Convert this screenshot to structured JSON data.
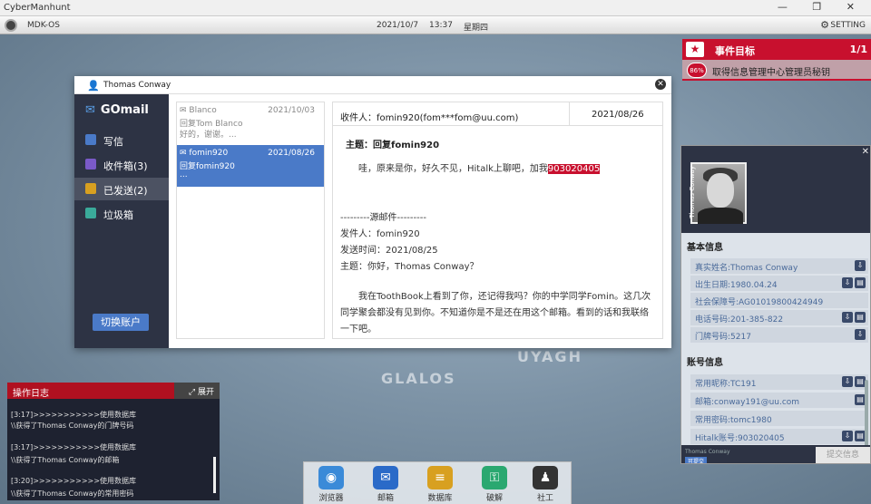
{
  "window": {
    "title": "CyberManhunt",
    "controls": "— ❐ ✕"
  },
  "topbar": {
    "os_name": "MDK-OS",
    "date": "2021/10/7",
    "time": "13:37",
    "weekday": "星期四",
    "setting_label": "SETTING"
  },
  "map_labels": [
    "GLALOS",
    "UYAGH"
  ],
  "mission": {
    "title": "事件目标",
    "progress": "1/1",
    "percent": "86%",
    "task": "取得信息管理中心管理员秘钥"
  },
  "mail": {
    "window_title": "Thomas Conway",
    "app_name": "GOmail",
    "nav": [
      {
        "label": "写信",
        "color": "#4a7ac8"
      },
      {
        "label": "收件箱(3)",
        "color": "#7a5ac8"
      },
      {
        "label": "已发送(2)",
        "color": "#d8a020"
      },
      {
        "label": "垃圾箱",
        "color": "#3aaa9a"
      }
    ],
    "switch_label": "切换账户",
    "list": [
      {
        "from": "Blanco",
        "date": "2021/10/03",
        "subject": "回复Tom Blanco",
        "preview": "好的，谢谢。..."
      },
      {
        "from": "fomin920",
        "date": "2021/08/26",
        "subject": "回复fomin920",
        "preview": "..."
      }
    ],
    "reader": {
      "to": "收件人：fomin920(fom***fom@uu.com)",
      "date": "2021/08/26",
      "subject": "主题：回复fomin920",
      "body_prefix": "哇，原来是你，好久不见，Hitalk上聊吧，加我",
      "body_highlight": "903020405",
      "separator": "---------源邮件---------",
      "orig_from": "发件人：fomin920",
      "orig_time": "发送时间：2021/08/25",
      "orig_subject": "主题：你好，Thomas Conway？",
      "orig_body": "我在ToothBook上看到了你，还记得我吗？你的中学同学Fomin。这几次同学聚会都没有见到你。不知道你是不是还在用这个邮箱。看到的话和我联络一下吧。"
    }
  },
  "profile": {
    "photo_name": "Thomas Conway",
    "basic_title": "基本信息",
    "basic": [
      "真实姓名:Thomas Conway",
      "出生日期:1980.04.24",
      "社会保障号:AG01019800424949",
      "电话号码:201-385-822",
      "门牌号码:5217"
    ],
    "account_title": "账号信息",
    "account": [
      "常用昵称:TC191",
      "邮箱:conway191@uu.com",
      "常用密码:tomc1980",
      "Hitalk账号:903020405"
    ],
    "footer_text": "Thomas Conway",
    "footer_tag": "可提交",
    "submit_label": "提交信息"
  },
  "log": {
    "title": "操作日志",
    "expand_label": "展开",
    "entries": [
      "[3:17]>>>>>>>>>>>使用数据库",
      "\\\\获得了Thomas Conway的门牌号码",
      "[3:17]>>>>>>>>>>>使用数据库",
      "\\\\获得了Thomas Conway的邮箱",
      "[3:20]>>>>>>>>>>>使用数据库",
      "\\\\获得了Thomas Conway的常用密码"
    ]
  },
  "dock": [
    {
      "label": "浏览器",
      "icon": "browser-icon",
      "color": "#3a8ad8",
      "glyph": "◉"
    },
    {
      "label": "邮箱",
      "icon": "mail-icon",
      "color": "#2a6ac8",
      "glyph": "✉"
    },
    {
      "label": "数据库",
      "icon": "database-icon",
      "color": "#d8a020",
      "glyph": "≡"
    },
    {
      "label": "破解",
      "icon": "crack-icon",
      "color": "#2aa870",
      "glyph": "⚿"
    },
    {
      "label": "社工",
      "icon": "social-icon",
      "color": "#333333",
      "glyph": "♟"
    }
  ]
}
